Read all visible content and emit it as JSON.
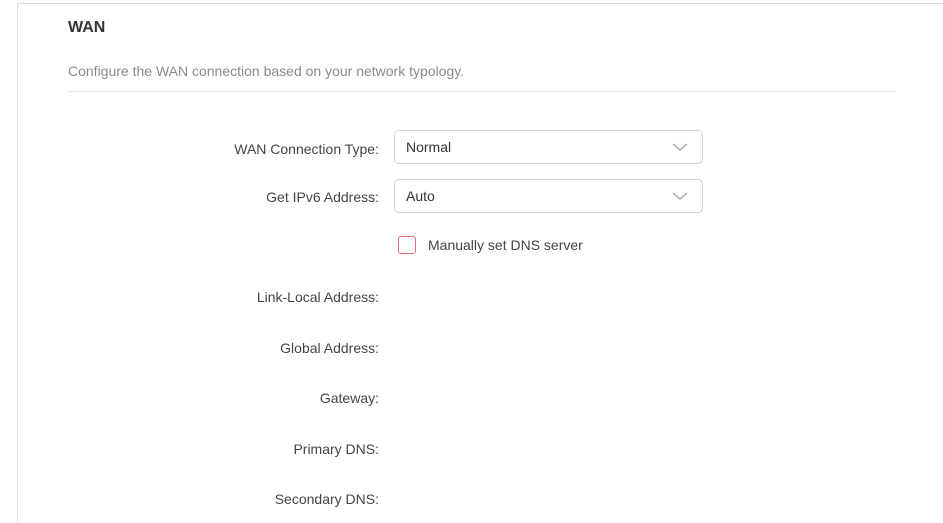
{
  "wan": {
    "title": "WAN",
    "description": "Configure the WAN connection based on your network typology."
  },
  "form": {
    "wan_connection_type": {
      "label": "WAN Connection Type:",
      "value": "Normal"
    },
    "get_ipv6_address": {
      "label": "Get IPv6 Address:",
      "value": "Auto"
    },
    "manual_dns": {
      "label": "Manually set DNS server",
      "checked": false
    },
    "link_local_address": {
      "label": "Link-Local Address:",
      "value": ""
    },
    "global_address": {
      "label": "Global Address:",
      "value": ""
    },
    "gateway": {
      "label": "Gateway:",
      "value": ""
    },
    "primary_dns": {
      "label": "Primary DNS:",
      "value": ""
    },
    "secondary_dns": {
      "label": "Secondary DNS:",
      "value": ""
    }
  },
  "colors": {
    "checkbox_border": "#e07070",
    "divider": "#e3e3e3",
    "description_text": "#8a8a8a"
  }
}
